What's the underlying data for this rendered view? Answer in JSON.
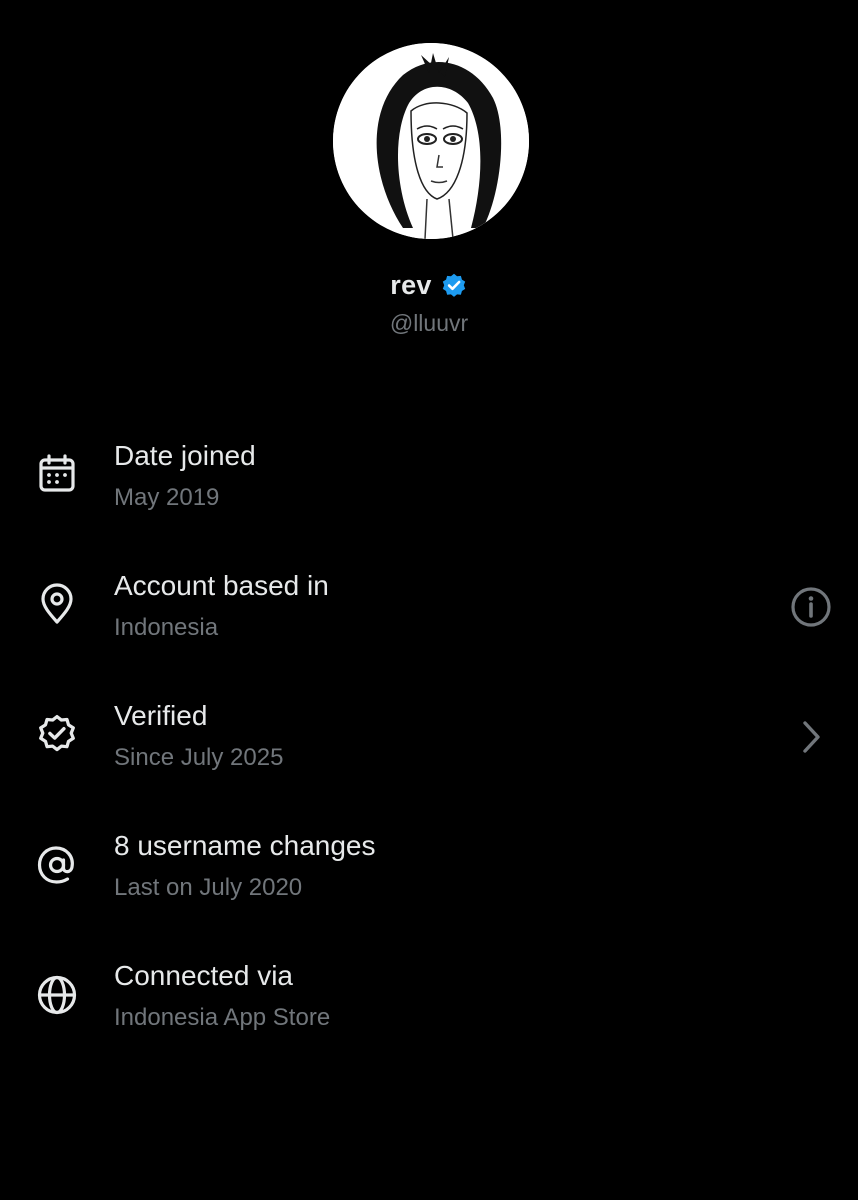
{
  "profile": {
    "display_name": "rev",
    "handle": "@lluuvr",
    "verified_badge_icon": "verified-check-icon",
    "badge_color": "#1d9bf0"
  },
  "rows": [
    {
      "icon": "calendar-icon",
      "title": "Date joined",
      "subtitle": "May 2019"
    },
    {
      "icon": "location-pin-icon",
      "title": "Account based in",
      "subtitle": "Indonesia",
      "action_icon": "info-icon"
    },
    {
      "icon": "verified-badge-outline-icon",
      "title": "Verified",
      "subtitle": "Since July 2025",
      "action_icon": "chevron-right-icon"
    },
    {
      "icon": "at-sign-icon",
      "title": "8 username changes",
      "subtitle": "Last on July 2020"
    },
    {
      "icon": "globe-icon",
      "title": "Connected via",
      "subtitle": "Indonesia App Store"
    }
  ],
  "colors": {
    "background": "#000000",
    "primary_text": "#e7e9ea",
    "secondary_text": "#71767b",
    "icon": "#e7e9ea"
  }
}
